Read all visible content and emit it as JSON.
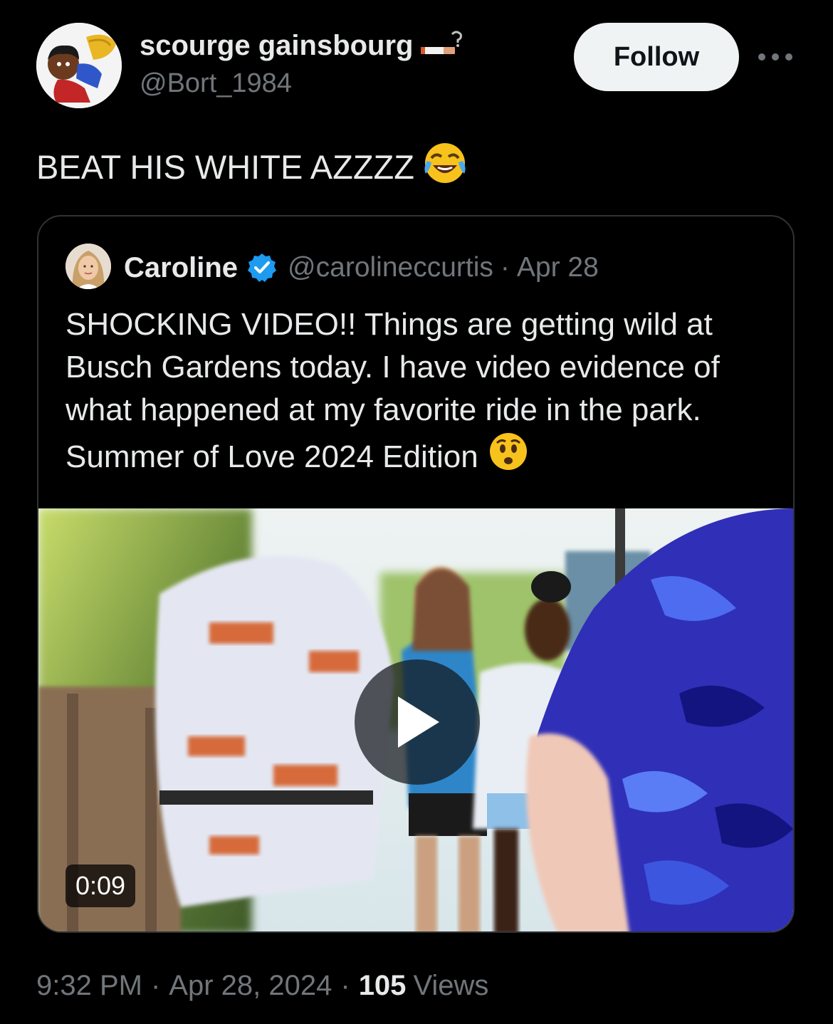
{
  "author": {
    "display_name": "scourge gainsbourg",
    "handle": "@Bort_1984",
    "name_emoji": "cigarette-icon"
  },
  "follow_label": "Follow",
  "tweet": {
    "text": "BEAT HIS WHITE AZZZZ",
    "emoji": "face-with-tears-of-joy-icon"
  },
  "quoted": {
    "display_name": "Caroline",
    "verified": true,
    "handle": "@carolineccurtis",
    "separator": "·",
    "date": "Apr 28",
    "text_lines": [
      "SHOCKING VIDEO!! Things are getting wild at",
      "Busch Gardens today. I have video evidence of",
      "what happened at my favorite ride in the park.",
      "Summer of Love 2024 Edition"
    ],
    "text_emoji": "worried-face-icon",
    "video": {
      "duration": "0:09"
    }
  },
  "meta": {
    "time": "9:32 PM",
    "sep1": "·",
    "date": "Apr 28, 2024",
    "sep2": "·",
    "views_count": "105",
    "views_label": "Views"
  },
  "colors": {
    "background": "#000000",
    "primary_text": "#e7e9ea",
    "secondary_text": "#71767b",
    "border": "#2f3336",
    "follow_bg": "#eff3f4",
    "verified_blue": "#1d9bf0"
  }
}
